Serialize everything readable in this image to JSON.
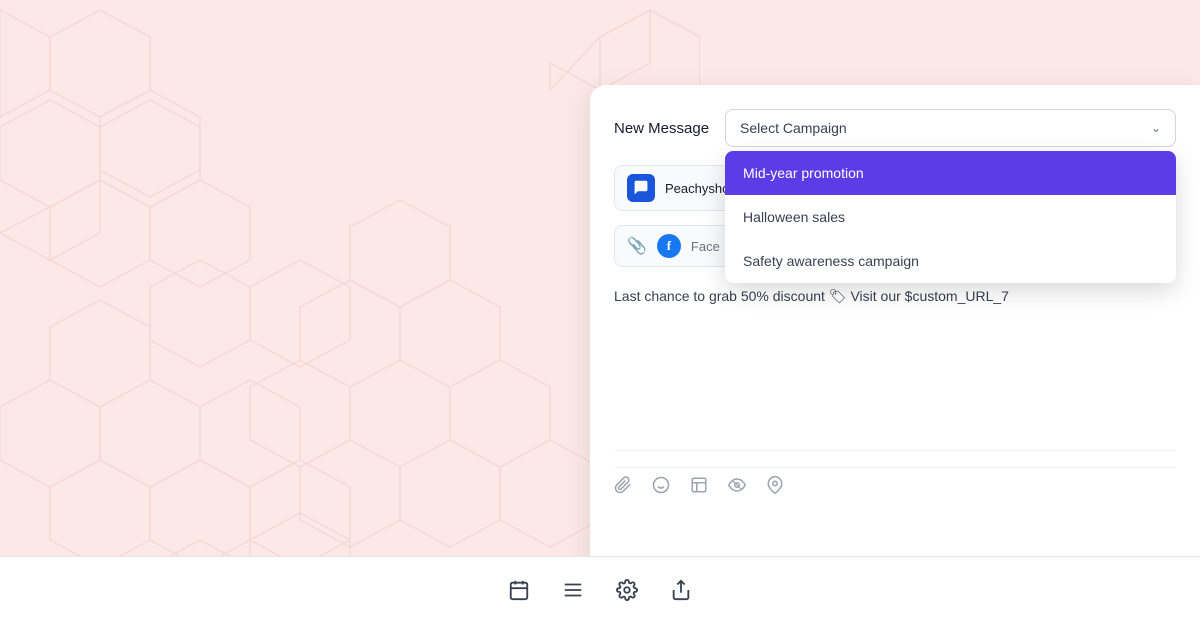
{
  "background": {
    "color": "#fce8e6"
  },
  "header": {
    "new_message_label": "New Message"
  },
  "campaign_dropdown": {
    "placeholder": "Select Campaign",
    "selected": null,
    "options": [
      {
        "id": "mid-year",
        "label": "Mid-year promotion",
        "active": true
      },
      {
        "id": "halloween",
        "label": "Halloween sales",
        "active": false
      },
      {
        "id": "safety",
        "label": "Safety awareness campaign",
        "active": false
      }
    ]
  },
  "recipient": {
    "name": "Peachyshoes",
    "close_label": "×"
  },
  "message_source": {
    "platform": "Face",
    "placeholder": "Face"
  },
  "message_body": {
    "text": "Last chance to grab 50% discount 🏷 Visit our $custom_URL_7"
  },
  "toolbar": {
    "icons": [
      {
        "name": "paperclip-icon",
        "symbol": "📎"
      },
      {
        "name": "emoji-icon",
        "symbol": "🙂"
      },
      {
        "name": "template-icon",
        "symbol": "⬜"
      },
      {
        "name": "eye-icon",
        "symbol": "👁"
      },
      {
        "name": "location-icon",
        "symbol": "📍"
      }
    ]
  },
  "bottom_bar": {
    "icons": [
      {
        "name": "calendar-icon",
        "symbol": "📅"
      },
      {
        "name": "list-icon",
        "symbol": "≡"
      },
      {
        "name": "settings-icon",
        "symbol": "⚙"
      },
      {
        "name": "share-icon",
        "symbol": "⬆"
      }
    ]
  }
}
